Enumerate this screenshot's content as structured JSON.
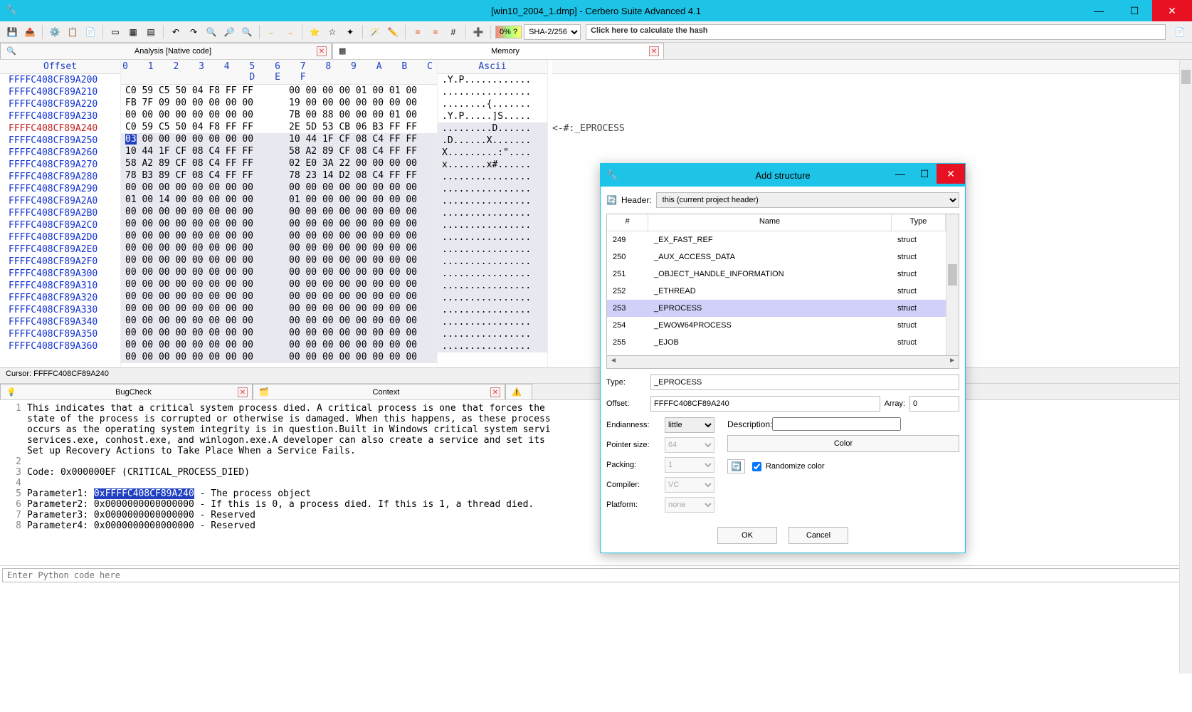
{
  "app": {
    "title": "[win10_2004_1.dmp] - Cerbero Suite Advanced 4.1"
  },
  "toolbar": {
    "pct": "0% ?",
    "hash_algo": "SHA-2/256",
    "hash_prompt": "Click here to calculate the hash"
  },
  "tabs": {
    "analysis": "Analysis [Native code]",
    "memory": "Memory"
  },
  "hexheader": {
    "offset": "Offset",
    "ascii": "Ascii",
    "cols": "0  1  2  3  4  5  6  7    8  9  A  B  C  D  E  F"
  },
  "hex_rows": [
    {
      "o": "FFFFC408CF89A200",
      "h1": "C0 59 C5 50 04 F8 FF FF",
      "h2": "00 00 00 00 01 00 01 00",
      "a": ".Y.P............"
    },
    {
      "o": "FFFFC408CF89A210",
      "h1": "FB 7F 09 00 00 00 00 00",
      "h2": "19 00 00 00 00 00 00 00",
      "a": "................"
    },
    {
      "o": "FFFFC408CF89A220",
      "h1": "00 00 00 00 00 00 00 00",
      "h2": "7B 00 88 00 00 00 01 00",
      "a": "........{......."
    },
    {
      "o": "FFFFC408CF89A230",
      "h1": "C0 59 C5 50 04 F8 FF FF",
      "h2": "2E 5D 53 CB 06 B3 FF FF",
      "a": ".Y.P.....]S....."
    },
    {
      "o": "FFFFC408CF89A240",
      "h1": "03 00 00 00 00 00 00 00",
      "h2": "10 44 1F CF 08 C4 FF FF",
      "a": ".........D......",
      "red": true,
      "sel": "03",
      "cm": "<-#:_EPROCESS",
      "hl": true
    },
    {
      "o": "FFFFC408CF89A250",
      "h1": "10 44 1F CF 08 C4 FF FF",
      "h2": "58 A2 89 CF 08 C4 FF FF",
      "a": ".D......X.......",
      "hl": true
    },
    {
      "o": "FFFFC408CF89A260",
      "h1": "58 A2 89 CF 08 C4 FF FF",
      "h2": "02 E0 3A 22 00 00 00 00",
      "a": "X.........:\"....",
      "hl": true
    },
    {
      "o": "FFFFC408CF89A270",
      "h1": "78 B3 89 CF 08 C4 FF FF",
      "h2": "78 23 14 D2 08 C4 FF FF",
      "a": "x.......x#......",
      "hl": true
    },
    {
      "o": "FFFFC408CF89A280",
      "h1": "00 00 00 00 00 00 00 00",
      "h2": "00 00 00 00 00 00 00 00",
      "a": "................",
      "hl": true
    },
    {
      "o": "FFFFC408CF89A290",
      "h1": "01 00 14 00 00 00 00 00",
      "h2": "01 00 00 00 00 00 00 00",
      "a": "................",
      "hl": true
    },
    {
      "o": "FFFFC408CF89A2A0",
      "h1": "00 00 00 00 00 00 00 00",
      "h2": "00 00 00 00 00 00 00 00",
      "a": "................",
      "hl": true
    },
    {
      "o": "FFFFC408CF89A2B0",
      "h1": "00 00 00 00 00 00 00 00",
      "h2": "00 00 00 00 00 00 00 00",
      "a": "................",
      "hl": true
    },
    {
      "o": "FFFFC408CF89A2C0",
      "h1": "00 00 00 00 00 00 00 00",
      "h2": "00 00 00 00 00 00 00 00",
      "a": "................",
      "hl": true
    },
    {
      "o": "FFFFC408CF89A2D0",
      "h1": "00 00 00 00 00 00 00 00",
      "h2": "00 00 00 00 00 00 00 00",
      "a": "................",
      "hl": true
    },
    {
      "o": "FFFFC408CF89A2E0",
      "h1": "00 00 00 00 00 00 00 00",
      "h2": "00 00 00 00 00 00 00 00",
      "a": "................",
      "hl": true
    },
    {
      "o": "FFFFC408CF89A2F0",
      "h1": "00 00 00 00 00 00 00 00",
      "h2": "00 00 00 00 00 00 00 00",
      "a": "................",
      "hl": true
    },
    {
      "o": "FFFFC408CF89A300",
      "h1": "00 00 00 00 00 00 00 00",
      "h2": "00 00 00 00 00 00 00 00",
      "a": "................",
      "hl": true
    },
    {
      "o": "FFFFC408CF89A310",
      "h1": "00 00 00 00 00 00 00 00",
      "h2": "00 00 00 00 00 00 00 00",
      "a": "................",
      "hl": true
    },
    {
      "o": "FFFFC408CF89A320",
      "h1": "00 00 00 00 00 00 00 00",
      "h2": "00 00 00 00 00 00 00 00",
      "a": "................",
      "hl": true
    },
    {
      "o": "FFFFC408CF89A330",
      "h1": "00 00 00 00 00 00 00 00",
      "h2": "00 00 00 00 00 00 00 00",
      "a": "................",
      "hl": true
    },
    {
      "o": "FFFFC408CF89A340",
      "h1": "00 00 00 00 00 00 00 00",
      "h2": "00 00 00 00 00 00 00 00",
      "a": "................",
      "hl": true
    },
    {
      "o": "FFFFC408CF89A350",
      "h1": "00 00 00 00 00 00 00 00",
      "h2": "00 00 00 00 00 00 00 00",
      "a": "................",
      "hl": true
    },
    {
      "o": "FFFFC408CF89A360",
      "h1": "00 00 00 00 00 00 00 00",
      "h2": "00 00 00 00 00 00 00 00",
      "a": "................",
      "hl": true
    }
  ],
  "status": {
    "cursor": "Cursor: FFFFC408CF89A240"
  },
  "btabs": {
    "bugcheck": "BugCheck",
    "context": "Context"
  },
  "code_lines": [
    {
      "n": "1",
      "t": "This indicates that a critical system process died. A critical process is one that forces the "
    },
    {
      "n": "",
      "t": "state of the process is corrupted or otherwise is damaged. When this happens, as these process"
    },
    {
      "n": "",
      "t": "occurs as the operating system integrity is in question.Built in Windows critical system servi"
    },
    {
      "n": "",
      "t": "services.exe, conhost.exe, and winlogon.exe.A developer can also create a service and set its "
    },
    {
      "n": "",
      "t": "Set up Recovery Actions to Take Place When a Service Fails."
    },
    {
      "n": "2",
      "t": ""
    },
    {
      "n": "3",
      "t": "Code: 0x000000EF (CRITICAL_PROCESS_DIED)"
    },
    {
      "n": "4",
      "t": ""
    },
    {
      "n": "5",
      "t": "Parameter1: ",
      "sel": "0xFFFFC408CF89A240",
      "after": " - The process object"
    },
    {
      "n": "6",
      "t": "Parameter2: 0x0000000000000000 - If this is 0, a process died. If this is 1, a thread died."
    },
    {
      "n": "7",
      "t": "Parameter3: 0x0000000000000000 - Reserved"
    },
    {
      "n": "8",
      "t": "Parameter4: 0x0000000000000000 - Reserved"
    }
  ],
  "python": {
    "placeholder": "Enter Python code here"
  },
  "modal": {
    "title": "Add structure",
    "header_label": "Header:",
    "header_value": "this (current project header)",
    "columns": {
      "c1": "#",
      "c2": "Name",
      "c3": "Type"
    },
    "rows": [
      {
        "n": "249",
        "name": "_EX_FAST_REF",
        "type": "struct"
      },
      {
        "n": "250",
        "name": "_AUX_ACCESS_DATA",
        "type": "struct"
      },
      {
        "n": "251",
        "name": "_OBJECT_HANDLE_INFORMATION",
        "type": "struct"
      },
      {
        "n": "252",
        "name": "_ETHREAD",
        "type": "struct"
      },
      {
        "n": "253",
        "name": "_EPROCESS",
        "type": "struct",
        "sel": true
      },
      {
        "n": "254",
        "name": "_EWOW64PROCESS",
        "type": "struct"
      },
      {
        "n": "255",
        "name": "_EJOB",
        "type": "struct"
      }
    ],
    "type_label": "Type:",
    "type_value": "_EPROCESS",
    "offset_label": "Offset:",
    "offset_value": "FFFFC408CF89A240",
    "array_label": "Array:",
    "array_value": "0",
    "endian_label": "Endianness:",
    "endian_value": "little",
    "ptr_label": "Pointer size:",
    "ptr_value": "64",
    "pack_label": "Packing:",
    "pack_value": "1",
    "comp_label": "Compiler:",
    "comp_value": "VC",
    "plat_label": "Platform:",
    "plat_value": "none",
    "desc_label": "Description:",
    "color_label": "Color",
    "rand_label": "Randomize color",
    "ok": "OK",
    "cancel": "Cancel"
  }
}
